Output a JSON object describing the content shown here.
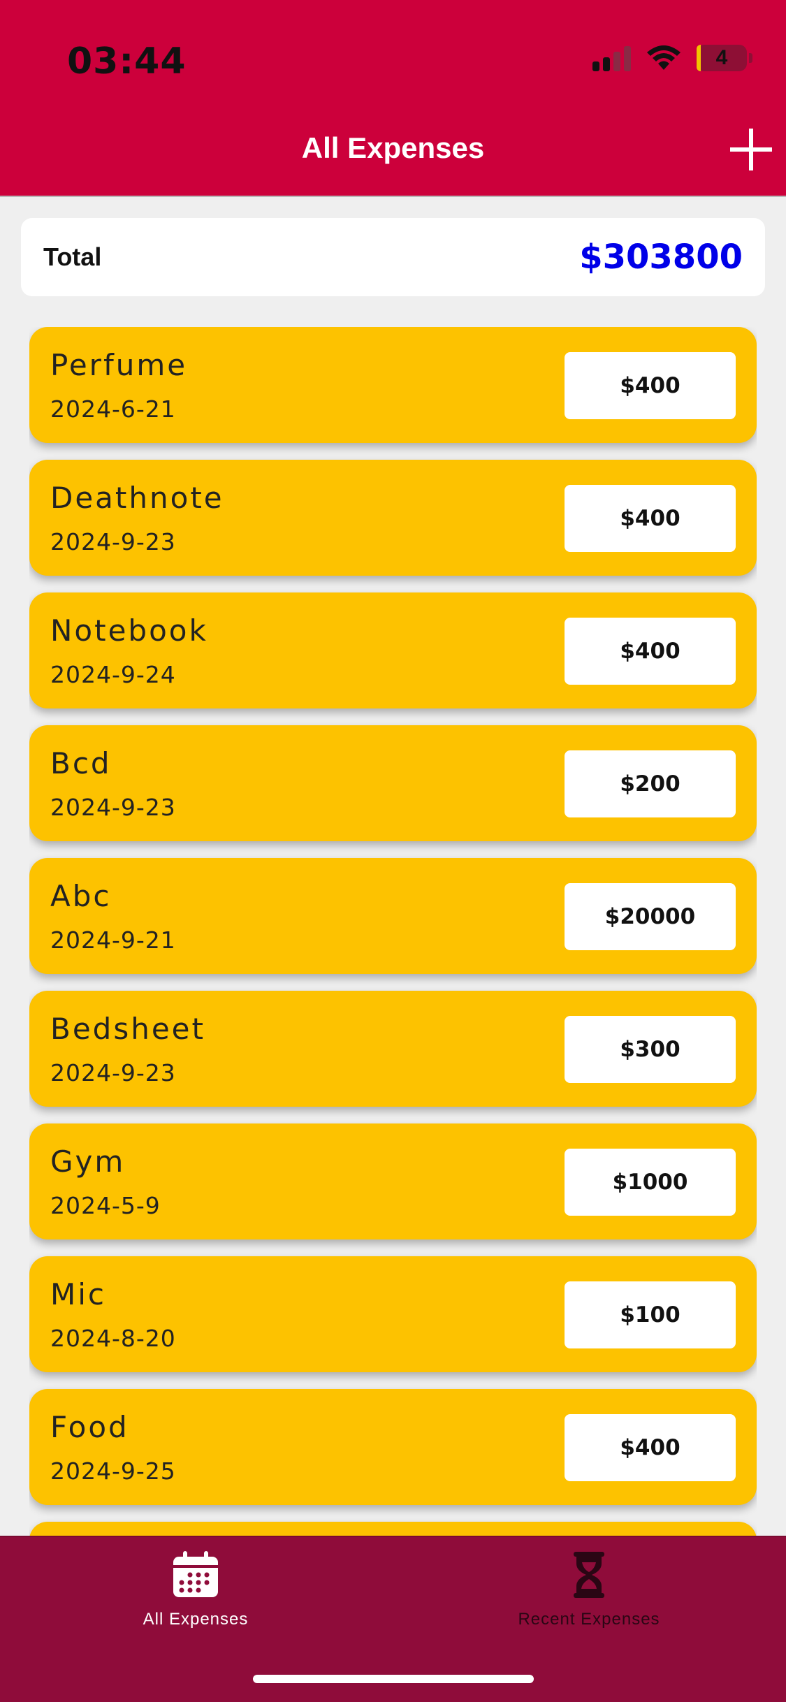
{
  "status_bar": {
    "time": "03:44",
    "battery_level": "4"
  },
  "header": {
    "title": "All Expenses",
    "add_icon": "plus-icon"
  },
  "summary": {
    "label": "Total",
    "value": "$303800",
    "value_color": "#0000e8"
  },
  "expenses": [
    {
      "name": "Perfume",
      "date": "2024-6-21",
      "amount": "$400"
    },
    {
      "name": "Deathnote",
      "date": "2024-9-23",
      "amount": "$400"
    },
    {
      "name": "Notebook",
      "date": "2024-9-24",
      "amount": "$400"
    },
    {
      "name": "Bcd",
      "date": "2024-9-23",
      "amount": "$200"
    },
    {
      "name": "Abc",
      "date": "2024-9-21",
      "amount": "$20000"
    },
    {
      "name": "Bedsheet",
      "date": "2024-9-23",
      "amount": "$300"
    },
    {
      "name": "Gym",
      "date": "2024-5-9",
      "amount": "$1000"
    },
    {
      "name": "Mic",
      "date": "2024-8-20",
      "amount": "$100"
    },
    {
      "name": "Food",
      "date": "2024-9-25",
      "amount": "$400"
    },
    {
      "name": "",
      "date": "",
      "amount": ""
    }
  ],
  "tabs": [
    {
      "label": "All Expenses",
      "icon": "calendar-icon",
      "active": true
    },
    {
      "label": "Recent Expenses",
      "icon": "hourglass-icon",
      "active": false
    }
  ],
  "colors": {
    "header": "#cc003b",
    "card": "#fdc200",
    "tabbar": "#8f0c3a"
  }
}
